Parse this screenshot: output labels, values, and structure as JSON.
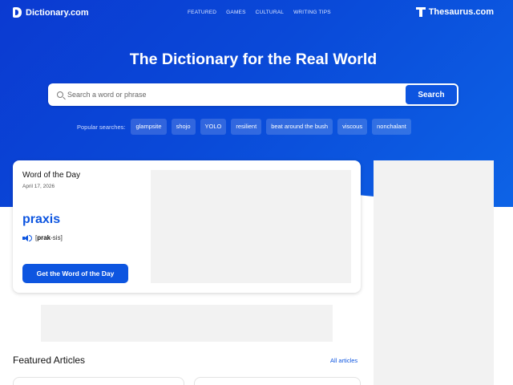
{
  "header": {
    "logo": "Dictionary.com",
    "nav": [
      "FEATURED",
      "GAMES",
      "CULTURAL",
      "WRITING TIPS"
    ],
    "thesaurus": "Thesaurus.com"
  },
  "hero": {
    "headline": "The Dictionary for the Real World",
    "search": {
      "placeholder": "Search a word or phrase",
      "button": "Search"
    },
    "popular_label": "Popular searches:",
    "popular": [
      "glampsite",
      "shojo",
      "YOLO",
      "resilient",
      "beat around the bush",
      "viscous",
      "nonchalant"
    ]
  },
  "word_of_the_day": {
    "title": "Word of the Day",
    "date": "April 17, 2026",
    "word": "praxis",
    "pron_open": "[",
    "pron_stress": "prak",
    "pron_rest": "-sis]",
    "button": "Get the Word of the Day"
  },
  "featured": {
    "title": "Featured Articles",
    "all_link": "All articles"
  },
  "colors": {
    "brand_blue": "#0d55e0",
    "hero_dark": "#0b3ad1",
    "ad_gray": "#f2f2f2"
  }
}
